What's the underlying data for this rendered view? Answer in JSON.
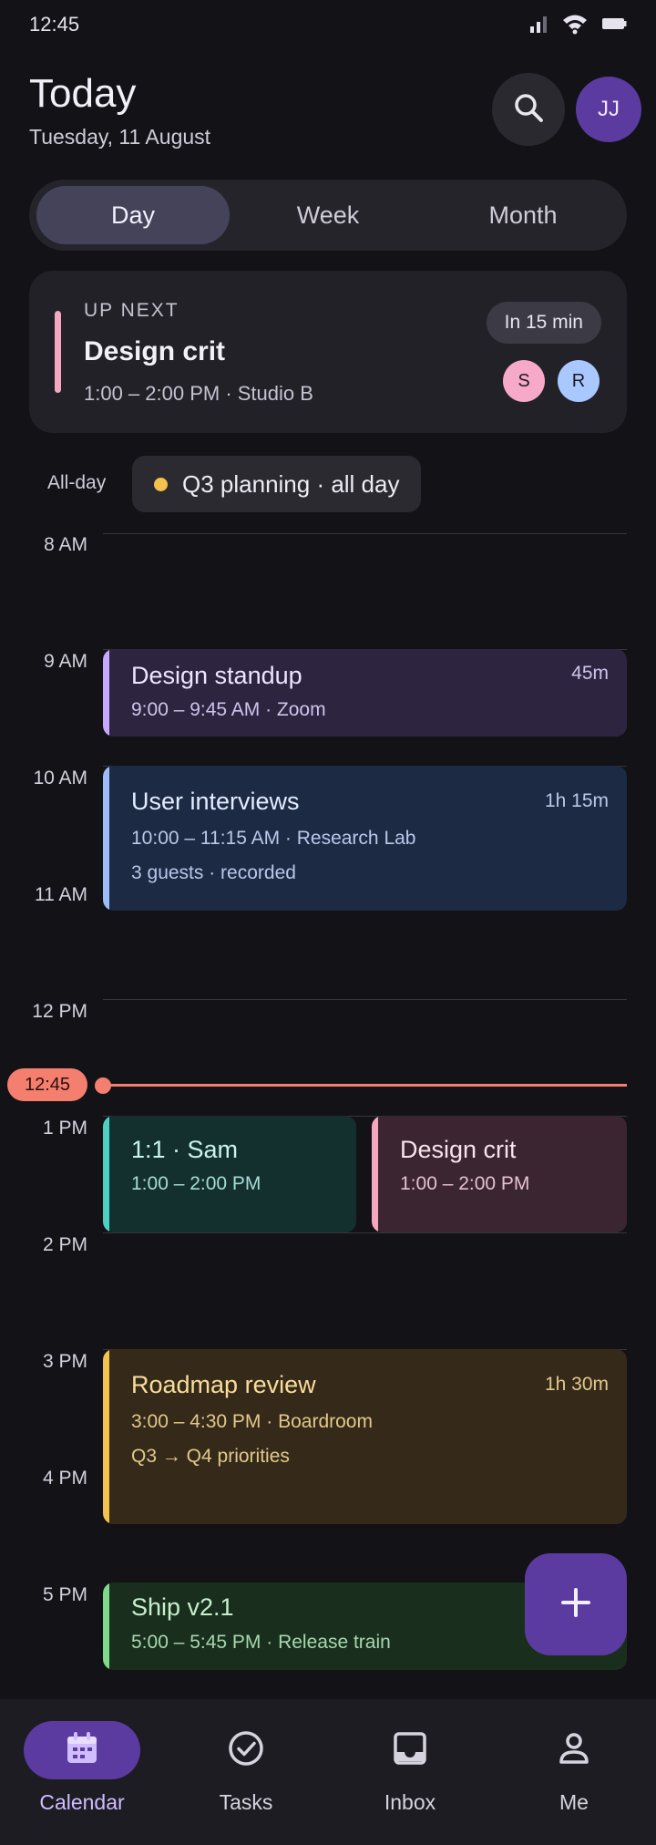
{
  "status_bar": {
    "time": "12:45",
    "icons": [
      "signal-icon",
      "wifi-icon",
      "battery-icon"
    ]
  },
  "header": {
    "title": "Today",
    "date": "Tuesday, 11 August",
    "avatar_initials": "JJ"
  },
  "view_tabs": [
    {
      "label": "Day",
      "selected": true
    },
    {
      "label": "Week",
      "selected": false
    },
    {
      "label": "Month",
      "selected": false
    }
  ],
  "up_next": {
    "eyebrow": "UP NEXT",
    "title": "Design crit",
    "meta": "1:00 – 2:00 PM · Studio B",
    "countdown": "In 15 min",
    "attendees": [
      {
        "initial": "S",
        "color": "#f6a9c8"
      },
      {
        "initial": "R",
        "color": "#a9c8ff"
      }
    ],
    "accent": "#f3a7c0"
  },
  "all_day": {
    "label": "All-day",
    "event": "Q3 planning · all day",
    "dot_color": "#f2c14e"
  },
  "hours": [
    "8 AM",
    "9 AM",
    "10 AM",
    "11 AM",
    "12 PM",
    "1 PM",
    "2 PM",
    "3 PM",
    "4 PM",
    "5 PM"
  ],
  "now_indicator": {
    "time": "12:45",
    "color": "#f47f6f"
  },
  "events": [
    {
      "title": "Design standup",
      "meta": "9:00 – 9:45 AM · Zoom",
      "duration": "45m",
      "accent": "#c6a8ff",
      "bg": "#2d2540"
    },
    {
      "title": "User interviews",
      "meta": "10:00 – 11:15 AM · Research Lab",
      "meta2": "3 guests · recorded",
      "duration": "1h 15m",
      "accent": "#9cbcf7",
      "bg": "#1c2a44"
    },
    {
      "title": "1:1 · Sam",
      "meta": "1:00 – 2:00 PM",
      "accent": "#4dd0c4",
      "bg": "#14302e"
    },
    {
      "title": "Design crit",
      "meta": "1:00 – 2:00 PM",
      "accent": "#f3a7c0",
      "bg": "#3a2530"
    },
    {
      "title": "Roadmap review",
      "meta": "3:00 – 4:30 PM · Boardroom",
      "meta2": "Q3 → Q4 priorities",
      "duration": "1h 30m",
      "accent": "#f2c14e",
      "bg": "#352a1a"
    },
    {
      "title": "Ship v2.1",
      "meta": "5:00 – 5:45 PM · Release train",
      "accent": "#7fd98a",
      "bg": "#1a2e1e"
    }
  ],
  "fab": {
    "icon": "plus-icon"
  },
  "bottom_nav": [
    {
      "label": "Calendar",
      "icon": "calendar-icon",
      "active": true
    },
    {
      "label": "Tasks",
      "icon": "check-circle-icon",
      "active": false
    },
    {
      "label": "Inbox",
      "icon": "inbox-icon",
      "active": false
    },
    {
      "label": "Me",
      "icon": "person-icon",
      "active": false
    }
  ]
}
